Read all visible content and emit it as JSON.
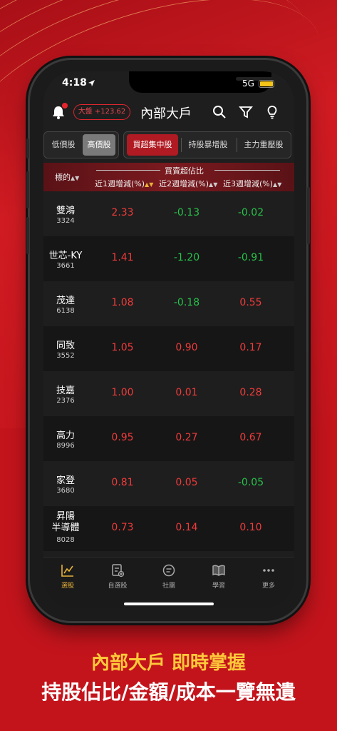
{
  "status": {
    "time": "4:18",
    "network": "5G"
  },
  "header": {
    "index_label": "大盤",
    "index_change": "+123.62",
    "title": "內部大戶"
  },
  "segments": {
    "price": [
      {
        "label": "低價股",
        "selected": false
      },
      {
        "label": "高價股",
        "selected": true
      }
    ],
    "category": [
      {
        "label": "買超集中股",
        "selected": true
      },
      {
        "label": "持股暴增股",
        "selected": false
      },
      {
        "label": "主力重壓股",
        "selected": false
      }
    ]
  },
  "table": {
    "symbol_header": "標的",
    "group_header": "買賣超佔比",
    "columns": [
      "近1週增減(%)",
      "近2週增減(%)",
      "近3週增減(%)"
    ],
    "rows": [
      {
        "name": "雙鴻",
        "code": "3324",
        "w1": "2.33",
        "w2": "-0.13",
        "w3": "-0.02"
      },
      {
        "name": "世芯-KY",
        "code": "3661",
        "w1": "1.41",
        "w2": "-1.20",
        "w3": "-0.91"
      },
      {
        "name": "茂達",
        "code": "6138",
        "w1": "1.08",
        "w2": "-0.18",
        "w3": "0.55"
      },
      {
        "name": "同致",
        "code": "3552",
        "w1": "1.05",
        "w2": "0.90",
        "w3": "0.17"
      },
      {
        "name": "技嘉",
        "code": "2376",
        "w1": "1.00",
        "w2": "0.01",
        "w3": "0.28"
      },
      {
        "name": "高力",
        "code": "8996",
        "w1": "0.95",
        "w2": "0.27",
        "w3": "0.67"
      },
      {
        "name": "家登",
        "code": "3680",
        "w1": "0.81",
        "w2": "0.05",
        "w3": "-0.05"
      },
      {
        "name": "昇陽\n半導體",
        "code": "8028",
        "w1": "0.73",
        "w2": "0.14",
        "w3": "0.10"
      }
    ]
  },
  "tabbar": [
    {
      "label": "選股",
      "icon": "chart-line-icon",
      "active": true
    },
    {
      "label": "自選股",
      "icon": "watchlist-icon",
      "active": false
    },
    {
      "label": "社團",
      "icon": "chat-icon",
      "active": false
    },
    {
      "label": "學習",
      "icon": "book-icon",
      "active": false
    },
    {
      "label": "更多",
      "icon": "more-icon",
      "active": false
    }
  ],
  "tagline": {
    "line1": "內部大戶 即時掌握",
    "line2": "持股佔比/金額/成本一覽無遺"
  },
  "colors": {
    "up": "#f03b3b",
    "down": "#27c14a",
    "accent": "#e8b23a",
    "brand_red": "#c3141c"
  }
}
